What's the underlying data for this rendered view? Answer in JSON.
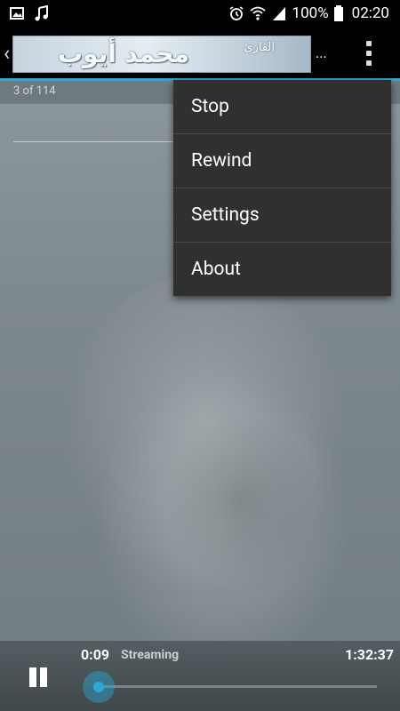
{
  "status_bar": {
    "battery": "100%",
    "time": "02:20"
  },
  "action_bar": {
    "banner_title": "محمد أيوب",
    "banner_subtitle": "القارئ",
    "ellipsis": "..."
  },
  "content": {
    "track_counter": "3 of 114"
  },
  "menu": {
    "items": [
      {
        "label": "Stop"
      },
      {
        "label": "Rewind"
      },
      {
        "label": "Settings"
      },
      {
        "label": "About"
      }
    ]
  },
  "player": {
    "elapsed": "0:09",
    "status": "Streaming",
    "total": "1:32:37",
    "progress_fraction": 0.0016
  },
  "colors": {
    "accent": "#2aa9d8",
    "menu_bg": "#303030"
  },
  "icons": [
    "gallery-icon",
    "music-note-icon",
    "alarm-icon",
    "wifi-icon",
    "signal-icon",
    "battery-icon",
    "chevron-left-icon",
    "overflow-menu-icon",
    "pause-icon"
  ]
}
